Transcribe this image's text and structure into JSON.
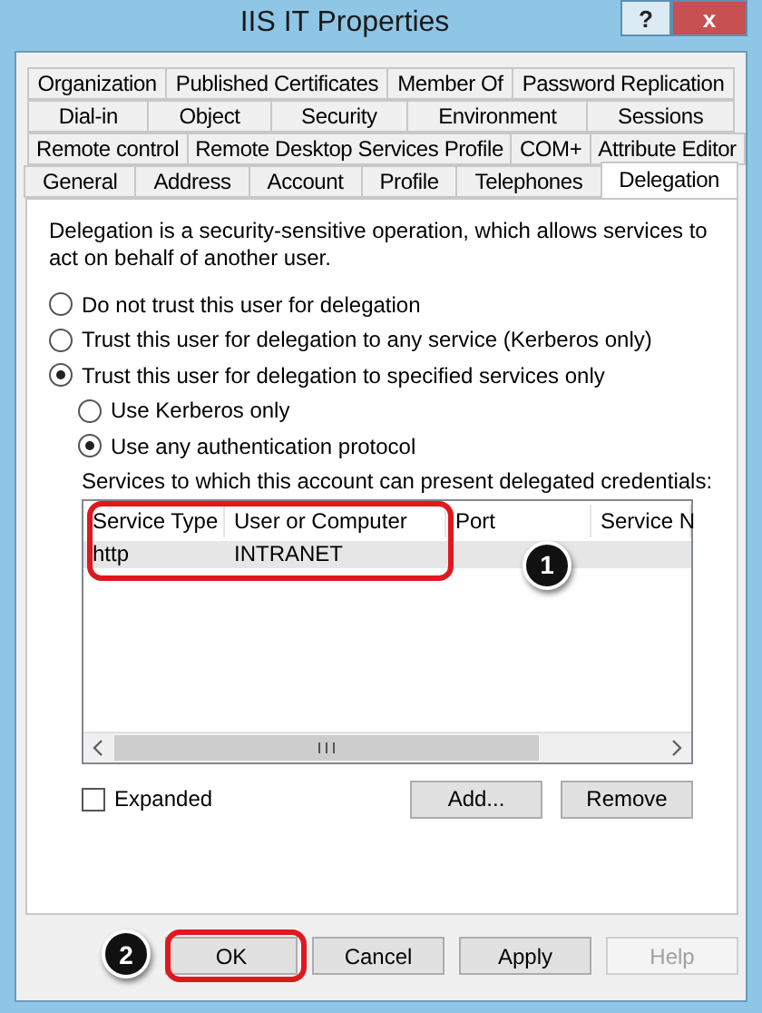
{
  "window": {
    "title": "IIS IT Properties",
    "help": "?",
    "close": "x"
  },
  "tab_rows": [
    [
      {
        "label": "Organization",
        "selected": false
      },
      {
        "label": "Published Certificates",
        "selected": false
      },
      {
        "label": "Member Of",
        "selected": false
      },
      {
        "label": "Password Replication",
        "selected": false
      }
    ],
    [
      {
        "label": "Dial-in",
        "selected": false
      },
      {
        "label": "Object",
        "selected": false
      },
      {
        "label": "Security",
        "selected": false
      },
      {
        "label": "Environment",
        "selected": false
      },
      {
        "label": "Sessions",
        "selected": false
      }
    ],
    [
      {
        "label": "Remote control",
        "selected": false
      },
      {
        "label": "Remote Desktop Services Profile",
        "selected": false
      },
      {
        "label": "COM+",
        "selected": false
      },
      {
        "label": "Attribute Editor",
        "selected": false
      }
    ],
    [
      {
        "label": "General",
        "selected": false
      },
      {
        "label": "Address",
        "selected": false
      },
      {
        "label": "Account",
        "selected": false
      },
      {
        "label": "Profile",
        "selected": false
      },
      {
        "label": "Telephones",
        "selected": false
      },
      {
        "label": "Delegation",
        "selected": true
      }
    ]
  ],
  "description": "Delegation is a security-sensitive operation, which allows services to act on behalf of another user.",
  "trust_options": [
    {
      "label": "Do not trust this user for delegation",
      "selected": false
    },
    {
      "label": "Trust this user for delegation to any service (Kerberos only)",
      "selected": false
    },
    {
      "label": "Trust this user for delegation to specified services only",
      "selected": true,
      "children": [
        {
          "label": "Use Kerberos only",
          "selected": false
        },
        {
          "label": "Use any authentication protocol",
          "selected": true
        }
      ]
    }
  ],
  "services_label": "Services to which this account can present delegated credentials:",
  "table": {
    "columns": [
      "Service Type",
      "User or Computer",
      "Port",
      "Service N"
    ],
    "rows": [
      {
        "cells": [
          "http",
          "INTRANET",
          "",
          ""
        ],
        "selected": true
      }
    ]
  },
  "expanded": {
    "label": "Expanded",
    "checked": false
  },
  "list_buttons": [
    "Add...",
    "Remove"
  ],
  "callouts": [
    "1",
    "2"
  ],
  "buttons": [
    {
      "label": "OK",
      "disabled": false
    },
    {
      "label": "Cancel",
      "disabled": false
    },
    {
      "label": "Apply",
      "disabled": false
    },
    {
      "label": "Help",
      "disabled": true
    }
  ]
}
